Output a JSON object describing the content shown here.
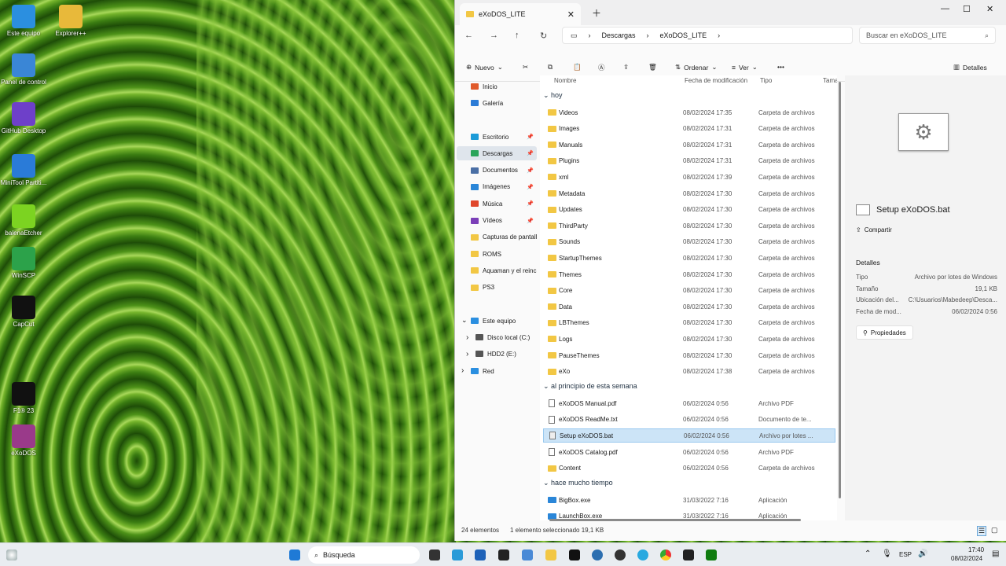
{
  "desktop": {
    "icons": [
      {
        "label": "Este equipo",
        "color": "#2b8fe0"
      },
      {
        "label": "Explorer++",
        "color": "#e8b93a"
      },
      {
        "label": "Panel de control",
        "color": "#3a86d6"
      },
      {
        "label": "GitHub Desktop",
        "color": "#6e40c9"
      },
      {
        "label": "MiniTool Partiti...",
        "color": "#2a7bd8"
      },
      {
        "label": "balenaEtcher",
        "color": "#7cd321"
      },
      {
        "label": "WinSCP",
        "color": "#2ca24a"
      },
      {
        "label": "CapCut",
        "color": "#111111"
      },
      {
        "label": "F1® 23",
        "color": "#111111"
      },
      {
        "label": "eXoDOS",
        "color": "#9a3a8a"
      }
    ]
  },
  "window": {
    "tab_title": "eXoDOS_LITE",
    "breadcrumb": [
      "Descargas",
      "eXoDOS_LITE"
    ],
    "search_placeholder": "Buscar en eXoDOS_LITE",
    "commands": {
      "new": "Nuevo",
      "sort": "Ordenar",
      "view": "Ver",
      "details": "Detalles"
    },
    "nav": {
      "top": [
        {
          "label": "Inicio",
          "color": "#e05a2b"
        },
        {
          "label": "Galería",
          "color": "#2b7bd6"
        }
      ],
      "quick": [
        {
          "label": "Escritorio",
          "color": "#1c9bd8"
        },
        {
          "label": "Descargas",
          "color": "#2aa45a",
          "selected": true
        },
        {
          "label": "Documentos",
          "color": "#4a6fa5"
        },
        {
          "label": "Imágenes",
          "color": "#2a86d8"
        },
        {
          "label": "Música",
          "color": "#e0462b"
        },
        {
          "label": "Vídeos",
          "color": "#7b3fb8"
        },
        {
          "label": "Capturas de pantall",
          "color": "#f2c744"
        },
        {
          "label": "ROMS",
          "color": "#f2c744"
        },
        {
          "label": "Aquaman y el reinc",
          "color": "#f2c744"
        },
        {
          "label": "PS3",
          "color": "#f2c744"
        }
      ],
      "this_pc": "Este equipo",
      "drives": [
        {
          "label": "Disco local (C:)"
        },
        {
          "label": "HDD2 (E:)"
        }
      ],
      "network": "Red"
    },
    "columns": {
      "name": "Nombre",
      "date": "Fecha de modificación",
      "type": "Tipo",
      "size": "Tama"
    },
    "groups": [
      {
        "label": "hoy",
        "rows": [
          {
            "name": "Videos",
            "date": "08/02/2024 17:35",
            "type": "Carpeta de archivos",
            "kind": "folder"
          },
          {
            "name": "Images",
            "date": "08/02/2024 17:31",
            "type": "Carpeta de archivos",
            "kind": "folder"
          },
          {
            "name": "Manuals",
            "date": "08/02/2024 17:31",
            "type": "Carpeta de archivos",
            "kind": "folder"
          },
          {
            "name": "Plugins",
            "date": "08/02/2024 17:31",
            "type": "Carpeta de archivos",
            "kind": "folder"
          },
          {
            "name": "xml",
            "date": "08/02/2024 17:39",
            "type": "Carpeta de archivos",
            "kind": "folder"
          },
          {
            "name": "Metadata",
            "date": "08/02/2024 17:30",
            "type": "Carpeta de archivos",
            "kind": "folder"
          },
          {
            "name": "Updates",
            "date": "08/02/2024 17:30",
            "type": "Carpeta de archivos",
            "kind": "folder"
          },
          {
            "name": "ThirdParty",
            "date": "08/02/2024 17:30",
            "type": "Carpeta de archivos",
            "kind": "folder"
          },
          {
            "name": "Sounds",
            "date": "08/02/2024 17:30",
            "type": "Carpeta de archivos",
            "kind": "folder"
          },
          {
            "name": "StartupThemes",
            "date": "08/02/2024 17:30",
            "type": "Carpeta de archivos",
            "kind": "folder"
          },
          {
            "name": "Themes",
            "date": "08/02/2024 17:30",
            "type": "Carpeta de archivos",
            "kind": "folder"
          },
          {
            "name": "Core",
            "date": "08/02/2024 17:30",
            "type": "Carpeta de archivos",
            "kind": "folder"
          },
          {
            "name": "Data",
            "date": "08/02/2024 17:30",
            "type": "Carpeta de archivos",
            "kind": "folder"
          },
          {
            "name": "LBThemes",
            "date": "08/02/2024 17:30",
            "type": "Carpeta de archivos",
            "kind": "folder"
          },
          {
            "name": "Logs",
            "date": "08/02/2024 17:30",
            "type": "Carpeta de archivos",
            "kind": "folder"
          },
          {
            "name": "PauseThemes",
            "date": "08/02/2024 17:30",
            "type": "Carpeta de archivos",
            "kind": "folder"
          },
          {
            "name": "eXo",
            "date": "08/02/2024 17:38",
            "type": "Carpeta de archivos",
            "kind": "folder"
          }
        ]
      },
      {
        "label": "al principio de esta semana",
        "rows": [
          {
            "name": "eXoDOS Manual.pdf",
            "date": "06/02/2024 0:56",
            "type": "Archivo PDF",
            "kind": "doc"
          },
          {
            "name": "eXoDOS ReadMe.txt",
            "date": "06/02/2024 0:56",
            "type": "Documento de te...",
            "kind": "doc"
          },
          {
            "name": "Setup eXoDOS.bat",
            "date": "06/02/2024 0:56",
            "type": "Archivo por lotes ...",
            "kind": "bat",
            "selected": true
          },
          {
            "name": "eXoDOS Catalog.pdf",
            "date": "06/02/2024 0:56",
            "type": "Archivo PDF",
            "kind": "doc"
          },
          {
            "name": "Content",
            "date": "06/02/2024 0:56",
            "type": "Carpeta de archivos",
            "kind": "folder"
          }
        ]
      },
      {
        "label": "hace mucho tiempo",
        "rows": [
          {
            "name": "BigBox.exe",
            "date": "31/03/2022 7:16",
            "type": "Aplicación",
            "kind": "exe"
          },
          {
            "name": "LaunchBox.exe",
            "date": "31/03/2022 7:16",
            "type": "Aplicación",
            "kind": "exe"
          }
        ]
      }
    ],
    "details": {
      "file_name": "Setup eXoDOS.bat",
      "share": "Compartir",
      "section": "Detalles",
      "props": [
        {
          "k": "Tipo",
          "v": "Archivo por lotes de Windows"
        },
        {
          "k": "Tamaño",
          "v": "19,1 KB"
        },
        {
          "k": "Ubicación del...",
          "v": "C:\\Usuarios\\Mabedeep\\Desca..."
        },
        {
          "k": "Fecha de mod...",
          "v": "06/02/2024 0:56"
        }
      ],
      "properties": "Propiedades"
    },
    "status": {
      "count": "24 elementos",
      "selection": "1 elemento seleccionado  19,1 KB"
    }
  },
  "taskbar": {
    "search": "Búsqueda",
    "lang": "ESP",
    "time": "17:40",
    "date": "08/02/2024"
  }
}
